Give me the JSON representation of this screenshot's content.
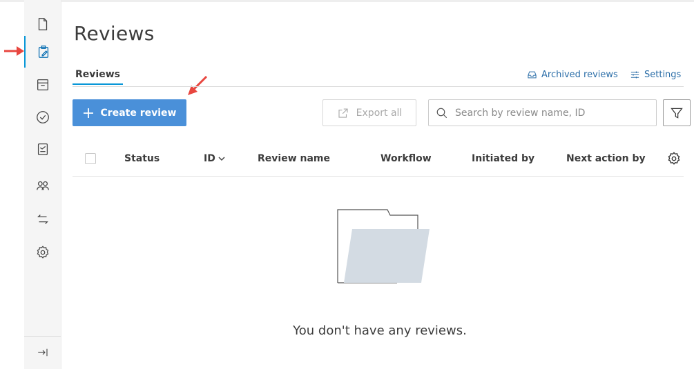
{
  "page": {
    "title": "Reviews"
  },
  "sidebar": {
    "items": [
      {
        "icon": "document-icon"
      },
      {
        "icon": "reviews-clipboard-icon",
        "active": true
      },
      {
        "icon": "archive-icon"
      },
      {
        "icon": "check-circle-icon"
      },
      {
        "icon": "report-icon"
      },
      {
        "icon": "members-icon"
      },
      {
        "icon": "transfer-icon"
      },
      {
        "icon": "gear-icon"
      }
    ],
    "collapse_icon": "collapse-right-icon"
  },
  "tabs": {
    "active_label": "Reviews"
  },
  "links": {
    "archived_label": "Archived reviews",
    "settings_label": "Settings"
  },
  "toolbar": {
    "create_label": "Create review",
    "export_label": "Export all",
    "search_placeholder": "Search by review name, ID"
  },
  "table": {
    "columns": [
      "Status",
      "ID",
      "Review name",
      "Workflow",
      "Initiated by",
      "Next action by"
    ]
  },
  "empty_state": {
    "message": "You don't have any reviews."
  },
  "colors": {
    "accent": "#4a90d9",
    "link": "#2b6ea8",
    "annotation_arrow": "#e8463f",
    "folder_fill": "#d3dbe3"
  }
}
